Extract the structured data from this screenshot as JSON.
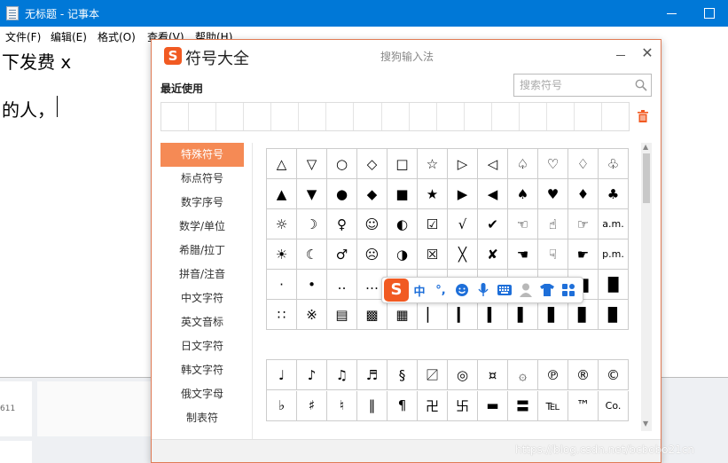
{
  "notepad": {
    "title": "无标题 - 记事本",
    "menu": [
      "文件(F)",
      "编辑(E)",
      "格式(O)",
      "查看(V)",
      "帮助(H)"
    ],
    "lines": [
      "下发费 x",
      "的人，"
    ]
  },
  "background": {
    "number": "611"
  },
  "dialog": {
    "title": "符号大全",
    "subtitle": "搜狗输入法",
    "recent_label": "最近使用",
    "search_placeholder": "搜索符号",
    "categories": [
      "特殊符号",
      "标点符号",
      "数字序号",
      "数学/单位",
      "希腊/拉丁",
      "拼音/注音",
      "中文字符",
      "英文音标",
      "日文字符",
      "韩文字符",
      "俄文字母",
      "制表符"
    ],
    "active_category": 0,
    "grid1": [
      [
        "△",
        "▽",
        "○",
        "◇",
        "□",
        "☆",
        "▷",
        "◁",
        "♤",
        "♡",
        "♢",
        "♧"
      ],
      [
        "▲",
        "▼",
        "●",
        "◆",
        "■",
        "★",
        "▶",
        "◀",
        "♠",
        "♥",
        "♦",
        "♣"
      ],
      [
        "☼",
        "☽",
        "♀",
        "☺",
        "◐",
        "☑",
        "√",
        "✔",
        "☜",
        "☝",
        "☞",
        "a.m."
      ],
      [
        "☀",
        "☾",
        "♂",
        "☹",
        "◑",
        "☒",
        "╳",
        "✘",
        "☚",
        "☟",
        "☛",
        "p.m."
      ],
      [
        "·",
        "•",
        "‥",
        "…",
        "▁",
        "▂",
        "▃",
        "▄",
        "▅",
        "▆",
        "▇",
        "█"
      ],
      [
        "∷",
        "※",
        "▤",
        "▩",
        "▦",
        "▏",
        "▎",
        "▍",
        "▌",
        "▋",
        "▊",
        "▉"
      ]
    ],
    "grid2": [
      [
        "♩",
        "♪",
        "♫",
        "♬",
        "§",
        "〼",
        "◎",
        "¤",
        "۞",
        "℗",
        "®",
        "©"
      ],
      [
        "♭",
        "♯",
        "♮",
        "‖",
        "¶",
        "卍",
        "卐",
        "▬",
        "〓",
        "℡",
        "™",
        "Co."
      ]
    ],
    "watermark": "https://blog.csdn.net/bcbobo21cn"
  },
  "ime_bar": {
    "logo": "S",
    "mode": "中",
    "punct": "°,",
    "items": [
      "emoji-icon",
      "microphone-icon",
      "keyboard-icon",
      "user-icon",
      "skin-icon",
      "apps-icon"
    ]
  },
  "colors": {
    "titlebar": "#0078d7",
    "accent": "#f58a55",
    "sogou": "#f15a22",
    "ime_blue": "#1e6fd9"
  }
}
